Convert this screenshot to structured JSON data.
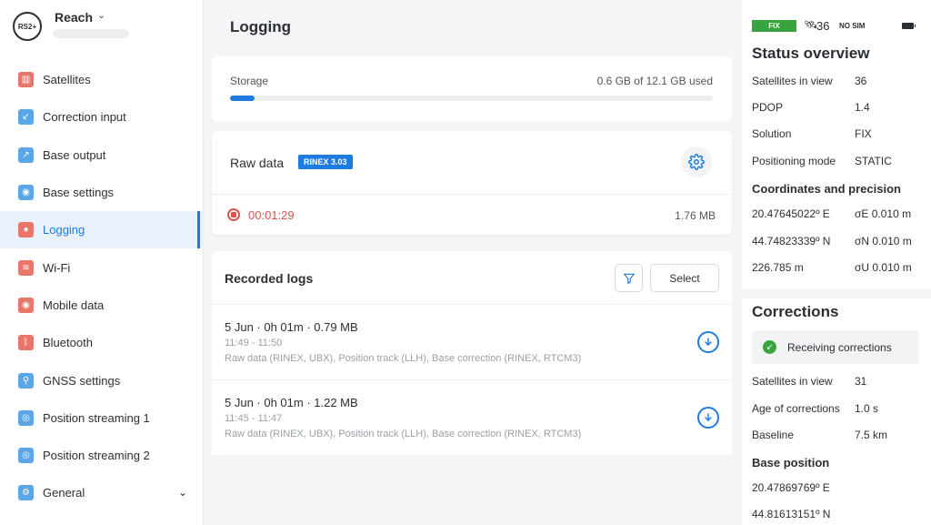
{
  "device": {
    "logo_text": "RS2+",
    "name": "Reach",
    "chevron_icon": "chevron-down-icon"
  },
  "sidebar": {
    "items": [
      {
        "label": "Satellites",
        "icon": "bar-chart-icon",
        "color": "#e8776a"
      },
      {
        "label": "Correction input",
        "icon": "arrow-down-left-icon",
        "color": "#5aa6e6"
      },
      {
        "label": "Base output",
        "icon": "arrow-up-right-icon",
        "color": "#5aa6e6"
      },
      {
        "label": "Base settings",
        "icon": "antenna-icon",
        "color": "#5aa6e6"
      },
      {
        "label": "Logging",
        "icon": "record-icon",
        "color": "#e8776a",
        "active": true
      },
      {
        "label": "Wi-Fi",
        "icon": "wifi-icon",
        "color": "#e8776a"
      },
      {
        "label": "Mobile data",
        "icon": "antenna-icon",
        "color": "#e8776a"
      },
      {
        "label": "Bluetooth",
        "icon": "bluetooth-icon",
        "color": "#e8776a"
      },
      {
        "label": "GNSS settings",
        "icon": "gnss-icon",
        "color": "#5aa6e6"
      },
      {
        "label": "Position streaming 1",
        "icon": "stream-icon",
        "color": "#5aa6e6"
      },
      {
        "label": "Position streaming 2",
        "icon": "stream-icon",
        "color": "#5aa6e6"
      },
      {
        "label": "General",
        "icon": "gear-icon",
        "color": "#5aa6e6"
      }
    ]
  },
  "main": {
    "title": "Logging",
    "storage": {
      "label": "Storage",
      "value": "0.6 GB of 12.1 GB used",
      "fraction": 0.05
    },
    "raw": {
      "title": "Raw data",
      "badge": "RINEX 3.03",
      "elapsed": "00:01:29",
      "size": "1.76 MB"
    },
    "logs": {
      "title": "Recorded logs",
      "select_label": "Select",
      "items": [
        {
          "main": "5 Jun · 0h 01m · 0.79 MB",
          "time": "11:49 - 11:50",
          "desc": "Raw data (RINEX, UBX), Position track (LLH), Base correction (RINEX, RTCM3)"
        },
        {
          "main": "5 Jun · 0h 01m · 1.22 MB",
          "time": "11:45 - 11:47",
          "desc": "Raw data (RINEX, UBX), Position track (LLH), Base correction (RINEX, RTCM3)"
        }
      ]
    }
  },
  "status": {
    "fix_badge": "FIX",
    "sat_count": "36",
    "sim": "NO SIM",
    "overview_title": "Status overview",
    "overview": [
      {
        "label": "Satellites in view",
        "value": "36"
      },
      {
        "label": "PDOP",
        "value": "1.4"
      },
      {
        "label": "Solution",
        "value": "FIX"
      },
      {
        "label": "Positioning mode",
        "value": "STATIC"
      }
    ],
    "coords_title": "Coordinates and precision",
    "coords": [
      {
        "value": "20.47645022º E",
        "sigma": "σE 0.010 m"
      },
      {
        "value": "44.74823339º N",
        "sigma": "σN 0.010 m"
      },
      {
        "value": "226.785 m",
        "sigma": "σU 0.010 m"
      }
    ],
    "corrections_title": "Corrections",
    "receiving": "Receiving corrections",
    "corrections": [
      {
        "label": "Satellites in view",
        "value": "31"
      },
      {
        "label": "Age of corrections",
        "value": "1.0 s"
      },
      {
        "label": "Baseline",
        "value": "7.5 km"
      }
    ],
    "base_title": "Base position",
    "base": [
      "20.47869769º E",
      "44.81613151º N"
    ]
  }
}
